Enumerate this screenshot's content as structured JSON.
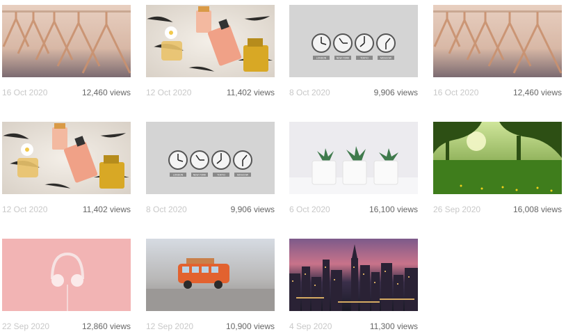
{
  "gallery": {
    "items": [
      {
        "image": "hangers-photo",
        "date": "16 Oct 2020",
        "views": "12,460 views"
      },
      {
        "image": "perfume-photo",
        "date": "12 Oct 2020",
        "views": "11,402 views"
      },
      {
        "image": "clocks-photo",
        "date": "8 Oct 2020",
        "views": "9,906 views"
      },
      {
        "image": "hangers-photo",
        "date": "16 Oct 2020",
        "views": "12,460 views"
      },
      {
        "image": "perfume-photo",
        "date": "12 Oct 2020",
        "views": "11,402 views"
      },
      {
        "image": "clocks-photo",
        "date": "8 Oct 2020",
        "views": "9,906 views"
      },
      {
        "image": "succulents-photo",
        "date": "6 Oct 2020",
        "views": "16,100 views"
      },
      {
        "image": "forest-meadow-photo",
        "date": "26 Sep 2020",
        "views": "16,008 views"
      },
      {
        "image": "headphones-photo",
        "date": "22 Sep 2020",
        "views": "12,860 views"
      },
      {
        "image": "toy-bus-photo",
        "date": "12 Sep 2020",
        "views": "10,900 views"
      },
      {
        "image": "city-skyline-photo",
        "date": "4 Sep 2020",
        "views": "11,300 views"
      }
    ],
    "clock_labels": [
      "LONDON",
      "NEW YORK",
      "TOKYO",
      "MOSCOW"
    ]
  }
}
